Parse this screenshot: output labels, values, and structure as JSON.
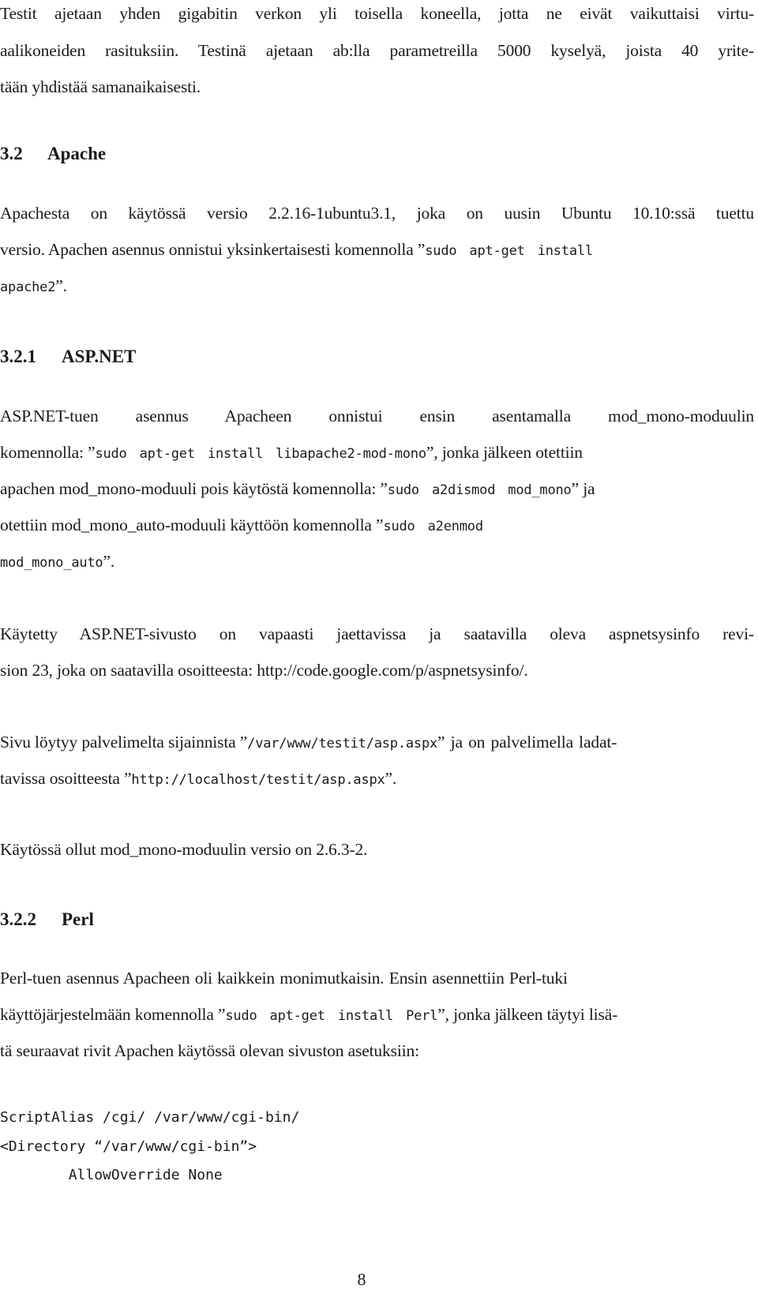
{
  "document": {
    "intro": {
      "l1": "Testit ajetaan yhden gigabitin verkon yli toisella koneella, jotta ne eivät vaikuttaisi virtu-",
      "l2": "aalikoneiden rasituksiin. Testinä ajetaan ab:lla parametreilla 5000 kyselyä, joista 40 yrite-",
      "l3": "tään yhdistää samanaikaisesti."
    },
    "section_3_2": {
      "number": "3.2",
      "title": "Apache",
      "l1": "Apachesta on käytössä versio 2.2.16-1ubuntu3.1, joka on uusin Ubuntu 10.10:ssä tuettu",
      "l2_text": "versio. Apachen asennus onnistui yksinkertaisesti komennolla ”",
      "l2_code": "sudo apt-get install",
      "l3_code": "apache2",
      "l3_text": "”."
    },
    "section_3_2_1": {
      "number": "3.2.1",
      "title": "ASP.NET",
      "p1": {
        "l1": "ASP.NET-tuen asennus Apacheen onnistui ensin asentamalla mod_mono-moduulin",
        "l2_text_a": "komennolla: ”",
        "l2_code": "sudo apt-get install libapache2-mod-mono",
        "l2_text_b": "”, jonka jälkeen otettiin",
        "l3_text_a": "apachen mod_mono-moduuli pois käytöstä komennolla: ”",
        "l3_code": "sudo a2dismod mod_mono",
        "l3_text_b": "” ja",
        "l4_text_a": "otettiin mod_mono_auto-moduuli käyttöön komennolla ”",
        "l4_code": "sudo a2enmod",
        "l5_code": "mod_mono_auto",
        "l5_text": "”."
      },
      "p2": {
        "l1": "Käytetty ASP.NET-sivusto on vapaasti jaettavissa ja saatavilla oleva aspnetsysinfo revi-",
        "l2_text": "sion 23, joka on saatavilla osoitteesta: ",
        "l2_link": "http://code.google.com/p/aspnetsysinfo/",
        "l2_end": "."
      },
      "p3": {
        "l1_text_a": "Sivu löytyy palvelimelta sijainnista ”",
        "l1_code": "/var/www/testit/asp.aspx",
        "l1_text_b": "” ja on palvelimella ladat-",
        "l2_text_a": "tavissa osoitteesta ”",
        "l2_code": "http://localhost/testit/asp.aspx",
        "l2_text_b": "”."
      },
      "p4": "Käytössä ollut mod_mono-moduulin versio on 2.6.3-2."
    },
    "section_3_2_2": {
      "number": "3.2.2",
      "title": "Perl",
      "p1": {
        "l1": "Perl-tuen asennus Apacheen oli kaikkein monimutkaisin. Ensin asennettiin Perl-tuki",
        "l2_text_a": "käyttöjärjestelmään komennolla ”",
        "l2_code": "sudo apt-get install Perl",
        "l2_text_b": "”, jonka jälkeen täytyi lisä-",
        "l3": "tä seuraavat rivit Apachen käytössä olevan sivuston asetuksiin:"
      },
      "code_lines": [
        "ScriptAlias /cgi/ /var/www/cgi-bin/",
        "<Directory “/var/www/cgi-bin”>",
        "        AllowOverride None"
      ]
    },
    "page_number": "8"
  }
}
